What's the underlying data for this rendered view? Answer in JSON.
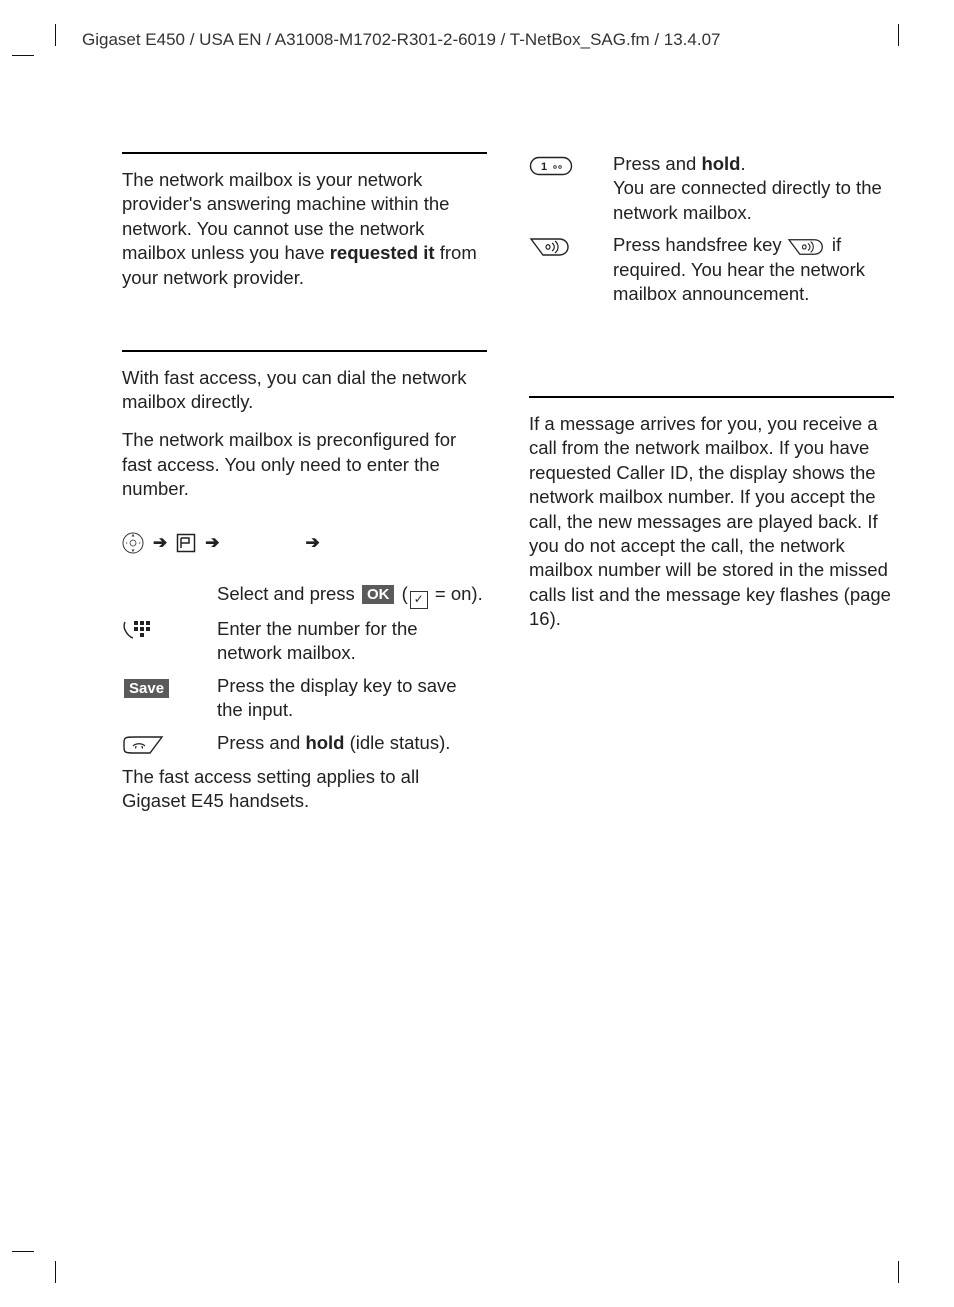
{
  "header_line": "Gigaset E450 / USA EN / A31008-M1702-R301-2-6019 / T-NetBox_SAG.fm / 13.4.07",
  "left": {
    "para1_pre": "The network mailbox is your network provider's answering machine within the network. You cannot use the network mailbox unless you have ",
    "para1_bold": "requested it",
    "para1_post": " from your network provider.",
    "para2": "With fast access, you can dial the network mailbox directly.",
    "para3": "The network mailbox is preconfigured for fast access. You only need to enter the number.",
    "row_ok_text_pre": "Select and press ",
    "row_ok_label": "OK",
    "row_ok_paren_pre": " (",
    "row_ok_paren_post": " = on).",
    "row_enter": "Enter the number for the network mailbox.",
    "row_save_label": "Save",
    "row_save_text": "Press the display key to save the input.",
    "row_hold_pre": "Press and ",
    "row_hold_bold": "hold",
    "row_hold_post": " (idle status).",
    "footer": "The fast access setting applies to all Gigaset E45 handsets."
  },
  "right": {
    "row1_pre": "Press and ",
    "row1_bold": "hold",
    "row1_post": ".",
    "row1_line2": "You are connected directly to the network mailbox.",
    "row2_pre": "Press handsfree key ",
    "row2_post": " if required. You hear the network mailbox announcement.",
    "para4": "If a message arrives for you, you receive a call from the network mailbox. If you have requested Caller ID, the display shows the network mailbox number. If you accept the call, the new messages are played back. If you do not accept the call, the network mailbox number will be stored in the missed calls list and the message key flashes (page 16)."
  }
}
